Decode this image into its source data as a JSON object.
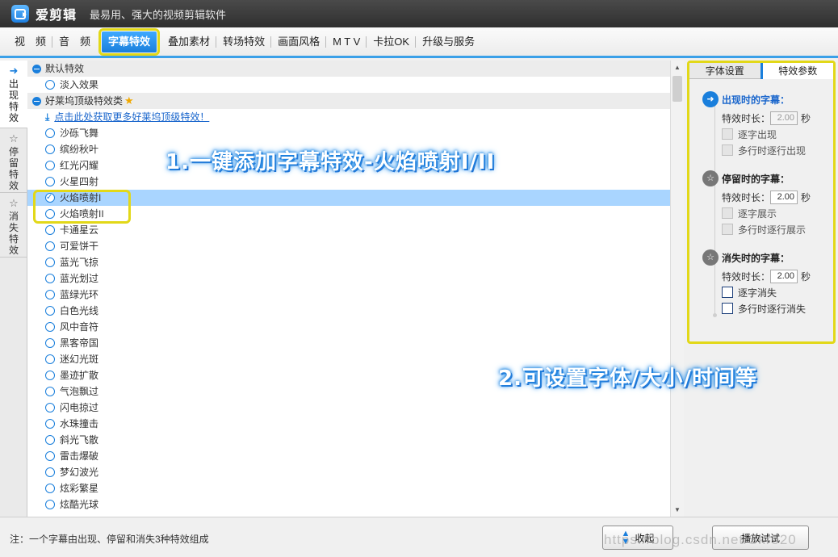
{
  "window": {
    "app_name": "爱剪辑",
    "slogan": "最易用、强大的视频剪辑软件"
  },
  "menu": [
    {
      "label": "视　频",
      "name": "tab-video"
    },
    {
      "label": "音　频",
      "name": "tab-audio"
    },
    {
      "label": "字幕特效",
      "name": "tab-subtitle-effects",
      "active": true
    },
    {
      "label": "叠加素材",
      "name": "tab-overlay"
    },
    {
      "label": "转场特效",
      "name": "tab-transitions"
    },
    {
      "label": "画面风格",
      "name": "tab-style"
    },
    {
      "label": "M T V",
      "name": "tab-mtv"
    },
    {
      "label": "卡拉OK",
      "name": "tab-karaoke"
    },
    {
      "label": "升级与服务",
      "name": "tab-upgrade"
    }
  ],
  "side_tabs": [
    {
      "label": "出现特效",
      "icon": "appear-icon",
      "glyph": "➜",
      "active": true
    },
    {
      "label": "停留特效",
      "icon": "stay-icon",
      "glyph": "☆"
    },
    {
      "label": "消失特效",
      "icon": "disappear-icon",
      "glyph": "☆"
    }
  ],
  "list": {
    "group_default": "默认特效",
    "item_fade": "淡入效果",
    "group_hollywood": "好莱坞顶级特效类",
    "download_link": "点击此处获取更多好莱坞顶级特效！",
    "items": [
      "沙砾飞舞",
      "缤纷秋叶",
      "红光闪耀",
      "火星四射",
      "火焰喷射I",
      "火焰喷射II",
      "卡通星云",
      "可爱饼干",
      "蓝光飞掠",
      "蓝光划过",
      "蓝绿光环",
      "白色光线",
      "风中音符",
      "黑客帝国",
      "迷幻光斑",
      "墨迹扩散",
      "气泡飘过",
      "闪电掠过",
      "水珠撞击",
      "斜光飞散",
      "雷击爆破",
      "梦幻波光",
      "炫彩繁星",
      "炫酷光球"
    ],
    "selected": "火焰喷射I"
  },
  "params": {
    "tab_font": "字体设置",
    "tab_effect": "特效参数",
    "duration_label": "特效时长：",
    "unit": "秒",
    "appear": {
      "title": "出现时的字幕：",
      "duration": "2.00",
      "opt1": "逐字出现",
      "opt2": "多行时逐行出现"
    },
    "stay": {
      "title": "停留时的字幕：",
      "duration": "2.00",
      "opt1": "逐字展示",
      "opt2": "多行时逐行展示"
    },
    "disappear": {
      "title": "消失时的字幕：",
      "duration": "2.00",
      "opt1": "逐字消失",
      "opt2": "多行时逐行消失"
    }
  },
  "captions": {
    "c1": "1.一键添加字幕特效-火焰喷射I/II",
    "c2": "2.可设置字体/大小/时间等"
  },
  "bottom": {
    "note": "注：一个字幕由出现、停留和消失3种特效组成",
    "collapse_label": "收起",
    "preview_label": "播放试试",
    "watermark": "https://blog.csdn.net/Skr520"
  },
  "colors": {
    "accent": "#1a7fdc",
    "highlight_box": "#e2d818",
    "selected_row": "#a9d5ff"
  }
}
